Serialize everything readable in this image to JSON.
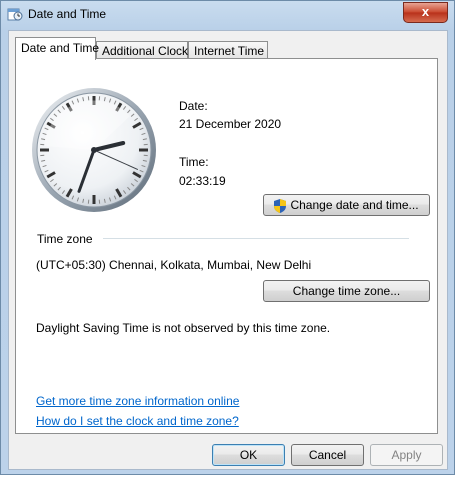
{
  "window": {
    "title": "Date and Time",
    "close_glyph": "x"
  },
  "tabs": [
    {
      "label": "Date and Time",
      "active": true
    },
    {
      "label": "Additional Clocks",
      "active": false
    },
    {
      "label": "Internet Time",
      "active": false
    }
  ],
  "date": {
    "label": "Date:",
    "value": "21 December 2020"
  },
  "time": {
    "label": "Time:",
    "value": "02:33:19"
  },
  "buttons": {
    "change_datetime": "Change date and time...",
    "change_timezone": "Change time zone...",
    "ok": "OK",
    "cancel": "Cancel",
    "apply": "Apply"
  },
  "timezone": {
    "section_label": "Time zone",
    "value": "(UTC+05:30) Chennai, Kolkata, Mumbai, New Delhi",
    "dst_note": "Daylight Saving Time is not observed by this time zone."
  },
  "links": {
    "more_info": "Get more time zone information online",
    "how_to": "How do I set the clock and time zone?"
  },
  "icons": {
    "title": "calendar-clock-icon",
    "shield": "uac-shield-icon",
    "clock": "analog-clock-icon"
  },
  "clock_face": {
    "hour": 2,
    "minute": 33,
    "second": 19
  }
}
